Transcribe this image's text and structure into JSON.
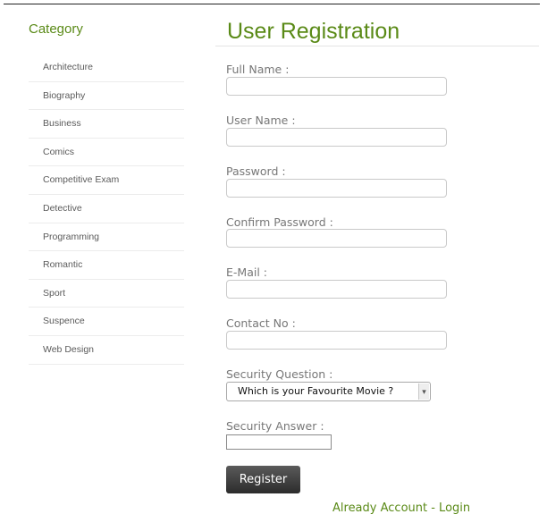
{
  "sidebar": {
    "title": "Category",
    "items": [
      "Architecture",
      "Biography",
      "Business",
      "Comics",
      "Competitive Exam",
      "Detective",
      "Programming",
      "Romantic",
      "Sport",
      "Suspence",
      "Web Design"
    ]
  },
  "form": {
    "title": "User Registration",
    "full_name_label": "Full Name :",
    "user_name_label": "User Name :",
    "password_label": "Password :",
    "confirm_password_label": "Confirm Password :",
    "email_label": "E-Mail :",
    "contact_label": "Contact No :",
    "security_question_label": "Security Question :",
    "security_question_value": "Which is your Favourite Movie ?",
    "security_answer_label": "Security Answer :",
    "register_label": "Register",
    "login_link": "Already Account - Login"
  },
  "colors": {
    "accent": "#5a8a17",
    "button": "#3a3a3a"
  }
}
